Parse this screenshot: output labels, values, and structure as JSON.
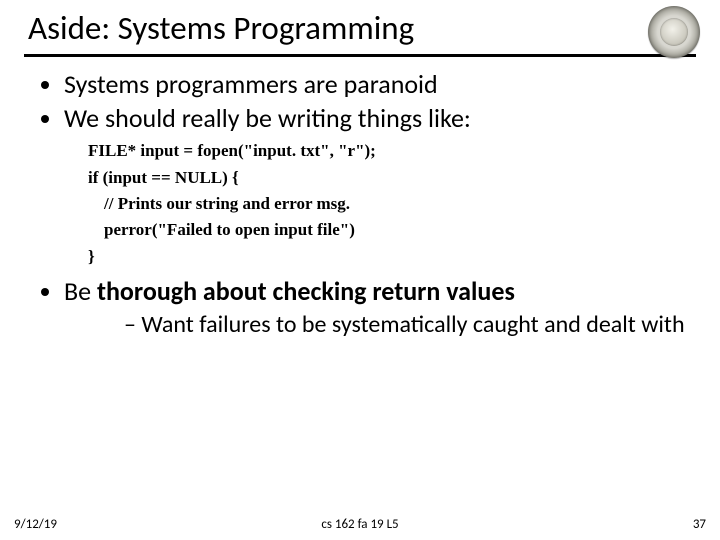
{
  "header": {
    "title": "Aside: Systems Programming"
  },
  "bullets": {
    "b1": "Systems programmers are paranoid",
    "b2": "We should really be writing things like:",
    "b3_pre": "Be ",
    "b3_bold": "thorough about checking return values",
    "sub1": "Want failures to be systematically caught and dealt with"
  },
  "code": {
    "l1": "FILE* input = fopen(\"input. txt\", \"r\");",
    "l2": "if (input == NULL) {",
    "l3": "// Prints our string and error msg.",
    "l4": "perror(\"Failed to open input file\")",
    "l5": "}"
  },
  "footer": {
    "date": "9/12/19",
    "mid": "cs 162 fa 19 L5",
    "num": "37"
  }
}
